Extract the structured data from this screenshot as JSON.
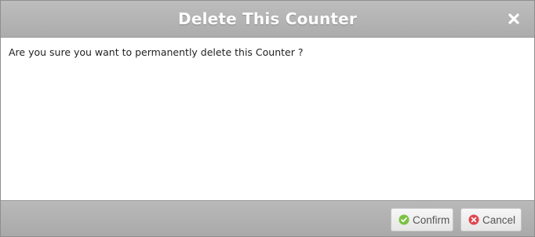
{
  "dialog": {
    "title": "Delete This Counter",
    "close_icon": "close-icon",
    "message": "Are you sure you want to permanently delete this Counter ?",
    "buttons": {
      "confirm_label": "Confirm",
      "confirm_icon": "check-circle-icon",
      "confirm_icon_color": "#7cc243",
      "cancel_label": "Cancel",
      "cancel_icon": "x-circle-icon",
      "cancel_icon_color": "#e0464d"
    }
  },
  "colors": {
    "titlebar": "#b5b5b5",
    "footer": "#b1b1b1",
    "title_text": "#ffffff"
  }
}
